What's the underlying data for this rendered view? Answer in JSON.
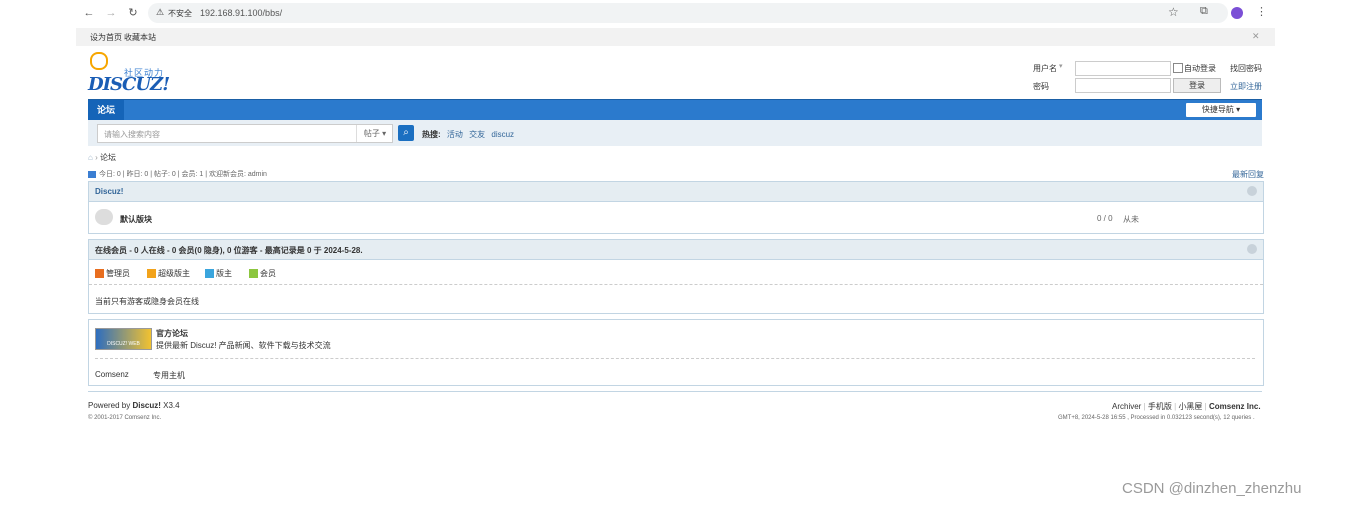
{
  "browser": {
    "security_label": "不安全",
    "url": "192.168.91.100/bbs/"
  },
  "topbar": {
    "set_home": "设为首页",
    "bookmark": "收藏本站"
  },
  "logo": {
    "slogan": "社区动力",
    "wordmark": "DISCUZ!"
  },
  "login": {
    "username_label": "用户名",
    "password_label": "密码",
    "auto_login": "自动登录",
    "forgot": "找回密码",
    "login_button": "登录",
    "register": "立即注册"
  },
  "nav": {
    "forum_tab": "论坛",
    "quick_nav": "快捷导航"
  },
  "search": {
    "placeholder": "请输入搜索内容",
    "scope": "帖子",
    "hot_label": "热搜:",
    "hot_terms": [
      "活动",
      "交友",
      "discuz"
    ]
  },
  "breadcrumb": {
    "current": "论坛"
  },
  "stats": {
    "text": "今日: 0 | 昨日: 0 | 帖子: 0 | 会员: 1 | 欢迎新会员: admin",
    "latest_replies": "最新回复"
  },
  "category": {
    "title": "Discuz!",
    "forum_name": "默认版块",
    "counts": "0 / 0",
    "last_post": "从未"
  },
  "online": {
    "title": "在线会员 - 0 人在线 - 0 会员(0 隐身), 0 位游客 - 最高记录是 0 于 2024-5-28.",
    "legend": [
      {
        "label": "管理员",
        "color": "#e86e1f"
      },
      {
        "label": "超级版主",
        "color": "#f2a31b"
      },
      {
        "label": "版主",
        "color": "#3aa5dd"
      },
      {
        "label": "会员",
        "color": "#8cc63f"
      }
    ],
    "note": "当前只有游客或隐身会员在线"
  },
  "links": {
    "official_title": "官方论坛",
    "official_desc": "提供最新 Discuz! 产品新闻、软件下载与技术交流",
    "badge_text": "DISCUZ! WEB",
    "partners": [
      "Comsenz",
      "专用主机"
    ]
  },
  "footer": {
    "powered_prefix": "Powered by ",
    "powered_brand": "Discuz!",
    "powered_version": " X3.4",
    "copyright": "© 2001-2017 Comsenz Inc.",
    "links": [
      "Archiver",
      "手机版",
      "小黑屋",
      "Comsenz Inc."
    ],
    "debug": "GMT+8, 2024-5-28 16:55 , Processed in 0.032123 second(s), 12 queries ."
  },
  "watermark": "CSDN @dinzhen_zhenzhu",
  "colors": {
    "nav_blue": "#2b7acd",
    "link_blue": "#336699",
    "box_border": "#c2d5e3",
    "box_head": "#e5edf2"
  }
}
